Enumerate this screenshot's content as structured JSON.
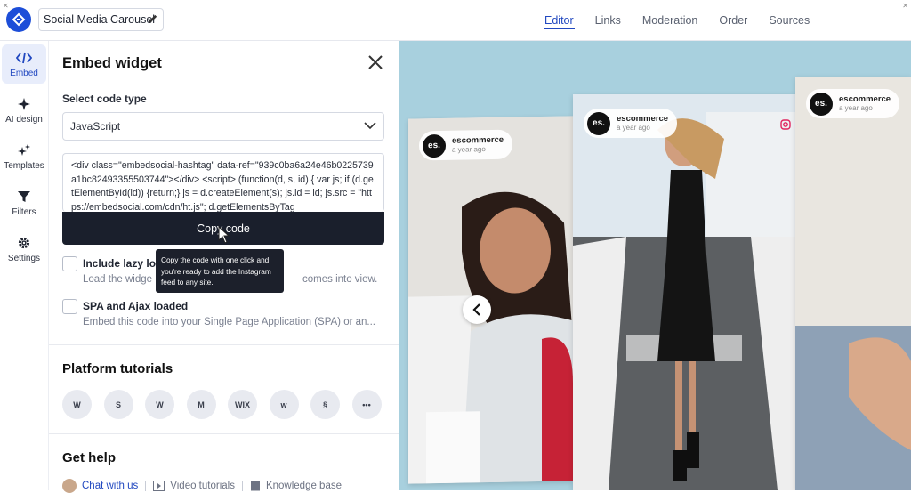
{
  "app": {
    "project_title": "Social Media Carousel",
    "tabs": [
      {
        "label": "Editor",
        "active": true
      },
      {
        "label": "Links",
        "active": false
      },
      {
        "label": "Moderation",
        "active": false
      },
      {
        "label": "Order",
        "active": false
      },
      {
        "label": "Sources",
        "active": false
      }
    ],
    "accent_color": "#2148c0"
  },
  "rail": {
    "items": [
      {
        "label": "Embed",
        "icon": "code-icon",
        "active": true
      },
      {
        "label": "AI design",
        "icon": "sparkle-icon",
        "active": false
      },
      {
        "label": "Templates",
        "icon": "sparkles-icon",
        "active": false
      },
      {
        "label": "Filters",
        "icon": "funnel-icon",
        "active": false
      },
      {
        "label": "Settings",
        "icon": "gear-icon",
        "active": false
      }
    ]
  },
  "panel": {
    "title": "Embed widget",
    "code_type_label": "Select code type",
    "code_type_value": "JavaScript",
    "code_text": "<div class=\"embedsocial-hashtag\" data-ref=\"939c0ba6a24e46b0225739a1bc82493355503744\"></div> <script> (function(d, s, id) { var js; if (d.getElementById(id)) {return;} js = d.createElement(s); js.id = id; js.src = \"https://embedsocial.com/cdn/ht.js\"; d.getElementsByTag",
    "copy_button": "Copy code",
    "tooltip": "Copy the code with one click and you're ready to add the Instagram feed to any site.",
    "lazy_title": "Include lazy loa",
    "lazy_desc": "Load the widge",
    "lazy_desc_tail": "comes into view.",
    "spa_title": "SPA and Ajax loaded",
    "spa_desc": "Embed this code into your Single Page Application (SPA) or an...",
    "tutorials_title": "Platform tutorials",
    "platforms": [
      {
        "name": "wordpress-icon",
        "glyph": "W"
      },
      {
        "name": "shopify-icon",
        "glyph": "S"
      },
      {
        "name": "webflow-w-icon",
        "glyph": "W"
      },
      {
        "name": "magento-icon",
        "glyph": "M"
      },
      {
        "name": "wix-icon",
        "glyph": "WIX"
      },
      {
        "name": "webflow-icon",
        "glyph": "w"
      },
      {
        "name": "squarespace-icon",
        "glyph": "§"
      },
      {
        "name": "more-icon",
        "glyph": "•••"
      }
    ],
    "help_title": "Get help",
    "help_links": [
      "Chat with us",
      "Video tutorials",
      "Knowledge base"
    ]
  },
  "preview": {
    "account_name": "escommerce",
    "account_time": "a year ago",
    "logo_text": "es."
  }
}
